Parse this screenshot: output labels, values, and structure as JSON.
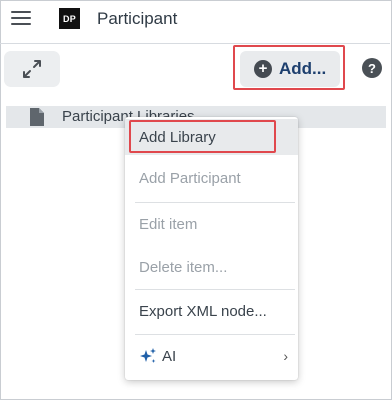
{
  "header": {
    "logo_text": "DP",
    "title": "Participant"
  },
  "toolbar": {
    "add_label": "Add...",
    "help_label": "?"
  },
  "tree": {
    "items": [
      {
        "label": "Participant Libraries",
        "icon": "document-icon"
      }
    ]
  },
  "context_menu": {
    "items": [
      {
        "label": "Add Library",
        "enabled": true
      },
      {
        "label": "Add Participant",
        "enabled": false
      },
      {
        "label": "Edit item",
        "enabled": false
      },
      {
        "label": "Delete item...",
        "enabled": false
      },
      {
        "label": "Export XML node...",
        "enabled": true
      },
      {
        "label": "AI",
        "enabled": true,
        "has_submenu": true,
        "icon": "sparkle-icon"
      }
    ]
  },
  "colors": {
    "highlight_border": "#e0484d",
    "add_text": "#1d3f6e",
    "ai_icon": "#1f5fa8"
  }
}
